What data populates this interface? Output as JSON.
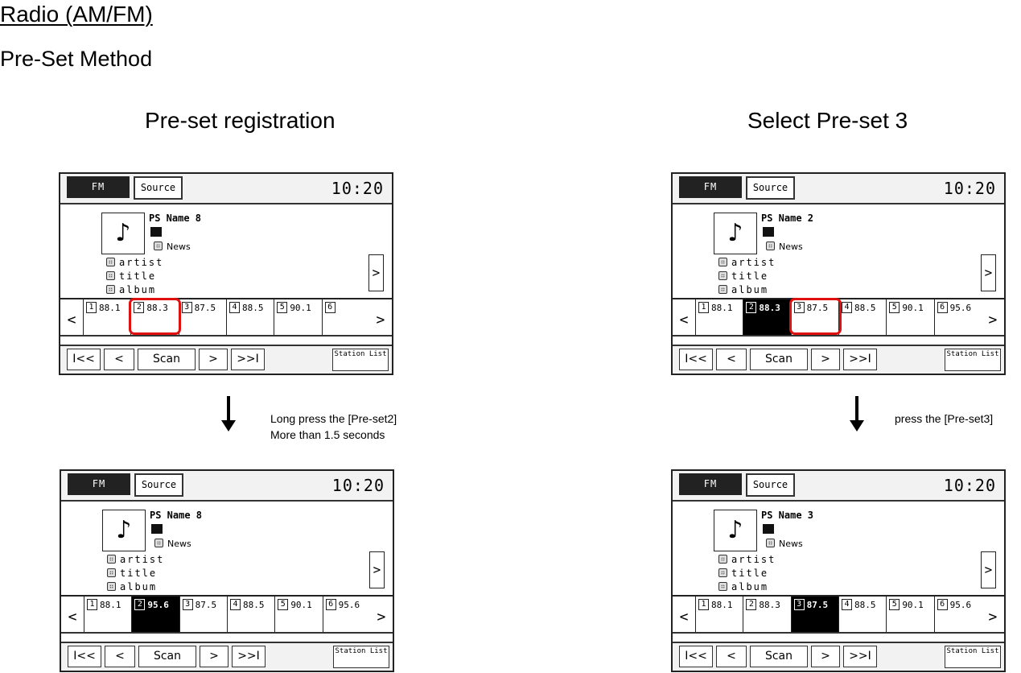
{
  "document": {
    "title": "Radio (AM/FM)",
    "subtitle": "Pre-Set Method"
  },
  "columns": [
    {
      "heading": "Pre-set registration",
      "instruction_lines": [
        "Long press the [Pre-set2]",
        "More than 1.5 seconds"
      ]
    },
    {
      "heading": "Select Pre-set 3",
      "instruction_lines": [
        "press the [Pre-set3]"
      ]
    }
  ],
  "highlight_color": "#e01010",
  "screens": [
    {
      "id": "registration-before",
      "band": "FM",
      "source_label": "Source",
      "clock": "10:20",
      "ps_name": "PS Name 8",
      "genre": "News",
      "meta": [
        "artist",
        "title",
        "album"
      ],
      "more_label": ">",
      "prev_page_label": "<",
      "next_page_label": ">",
      "presets": [
        {
          "num": "1",
          "freq": "88.1"
        },
        {
          "num": "2",
          "freq": "88.3"
        },
        {
          "num": "3",
          "freq": "87.5"
        },
        {
          "num": "4",
          "freq": "88.5"
        },
        {
          "num": "5",
          "freq": "90.1"
        },
        {
          "num": "6",
          "freq": ""
        }
      ],
      "active_preset": null,
      "highlighted_preset": 2,
      "controls": {
        "first": "I<<",
        "prev": "<",
        "scan": "Scan",
        "next": ">",
        "last": ">>I",
        "station_list": "Station List"
      }
    },
    {
      "id": "registration-after",
      "band": "FM",
      "source_label": "Source",
      "clock": "10:20",
      "ps_name": "PS Name 8",
      "genre": "News",
      "meta": [
        "artist",
        "title",
        "album"
      ],
      "more_label": ">",
      "prev_page_label": "<",
      "next_page_label": ">",
      "presets": [
        {
          "num": "1",
          "freq": "88.1"
        },
        {
          "num": "2",
          "freq": "95.6"
        },
        {
          "num": "3",
          "freq": "87.5"
        },
        {
          "num": "4",
          "freq": "88.5"
        },
        {
          "num": "5",
          "freq": "90.1"
        },
        {
          "num": "6",
          "freq": "95.6"
        }
      ],
      "active_preset": 2,
      "highlighted_preset": null,
      "controls": {
        "first": "I<<",
        "prev": "<",
        "scan": "Scan",
        "next": ">",
        "last": ">>I",
        "station_list": "Station List"
      }
    },
    {
      "id": "select-before",
      "band": "FM",
      "source_label": "Source",
      "clock": "10:20",
      "ps_name": "PS Name 2",
      "genre": "News",
      "meta": [
        "artist",
        "title",
        "album"
      ],
      "more_label": ">",
      "prev_page_label": "<",
      "next_page_label": ">",
      "presets": [
        {
          "num": "1",
          "freq": "88.1"
        },
        {
          "num": "2",
          "freq": "88.3"
        },
        {
          "num": "3",
          "freq": "87.5"
        },
        {
          "num": "4",
          "freq": "88.5"
        },
        {
          "num": "5",
          "freq": "90.1"
        },
        {
          "num": "6",
          "freq": "95.6"
        }
      ],
      "active_preset": 2,
      "highlighted_preset": 3,
      "controls": {
        "first": "I<<",
        "prev": "<",
        "scan": "Scan",
        "next": ">",
        "last": ">>I",
        "station_list": "Station List"
      }
    },
    {
      "id": "select-after",
      "band": "FM",
      "source_label": "Source",
      "clock": "10:20",
      "ps_name": "PS Name 3",
      "genre": "News",
      "meta": [
        "artist",
        "title",
        "album"
      ],
      "more_label": ">",
      "prev_page_label": "<",
      "next_page_label": ">",
      "presets": [
        {
          "num": "1",
          "freq": "88.1"
        },
        {
          "num": "2",
          "freq": "88.3"
        },
        {
          "num": "3",
          "freq": "87.5"
        },
        {
          "num": "4",
          "freq": "88.5"
        },
        {
          "num": "5",
          "freq": "90.1"
        },
        {
          "num": "6",
          "freq": "95.6"
        }
      ],
      "active_preset": 3,
      "highlighted_preset": null,
      "controls": {
        "first": "I<<",
        "prev": "<",
        "scan": "Scan",
        "next": ">",
        "last": ">>I",
        "station_list": "Station List"
      }
    }
  ]
}
